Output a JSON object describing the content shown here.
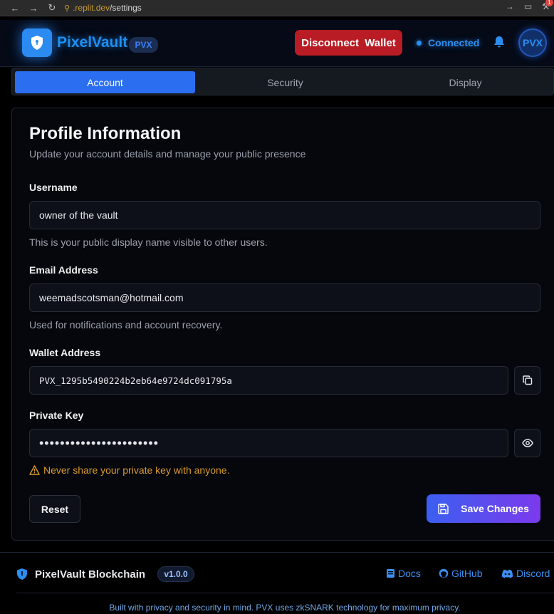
{
  "browser": {
    "url_host": ".replit.dev",
    "url_path": "/settings",
    "ext_badge_count": "1"
  },
  "header": {
    "brand": "PixelVault",
    "brand_badge": "PVX",
    "disconnect_label": "Disconnect  Wallet",
    "status_label": "Connected",
    "avatar_text": "PVX"
  },
  "tabs": [
    {
      "label": "Account",
      "active": true
    },
    {
      "label": "Security",
      "active": false
    },
    {
      "label": "Display",
      "active": false
    }
  ],
  "profile": {
    "title": "Profile Information",
    "subtitle": "Update your account details and manage your public presence",
    "username_label": "Username",
    "username_value": "owner of the vault",
    "username_help": "This is your public display name visible to other users.",
    "email_label": "Email Address",
    "email_value": "weemadscotsman@hotmail.com",
    "email_help": "Used for notifications and account recovery.",
    "wallet_label": "Wallet Address",
    "wallet_value": "PVX_1295b5490224b2eb64e9724dc091795a",
    "key_label": "Private Key",
    "key_value": "•••••••••••••••••••••••",
    "key_warning": "Never share your private key with anyone.",
    "reset_label": "Reset",
    "save_label": "Save Changes"
  },
  "footer": {
    "brand": "PixelVault Blockchain",
    "version": "v1.0.0",
    "links": [
      "Docs",
      "GitHub",
      "Discord"
    ],
    "tagline": "Built with privacy and security in mind. PVX uses zkSNARK technology for maximum privacy."
  },
  "colors": {
    "accent": "#2b6ef0",
    "danger": "#b91c24",
    "warning": "#d99a2b",
    "brand_blue": "#1d8ff2"
  },
  "icons": [
    "back-icon",
    "forward-icon",
    "reload-icon",
    "shield-icon",
    "bell-icon",
    "copy-icon",
    "eye-icon",
    "warning-icon",
    "save-icon",
    "docs-icon",
    "github-icon",
    "discord-icon"
  ]
}
